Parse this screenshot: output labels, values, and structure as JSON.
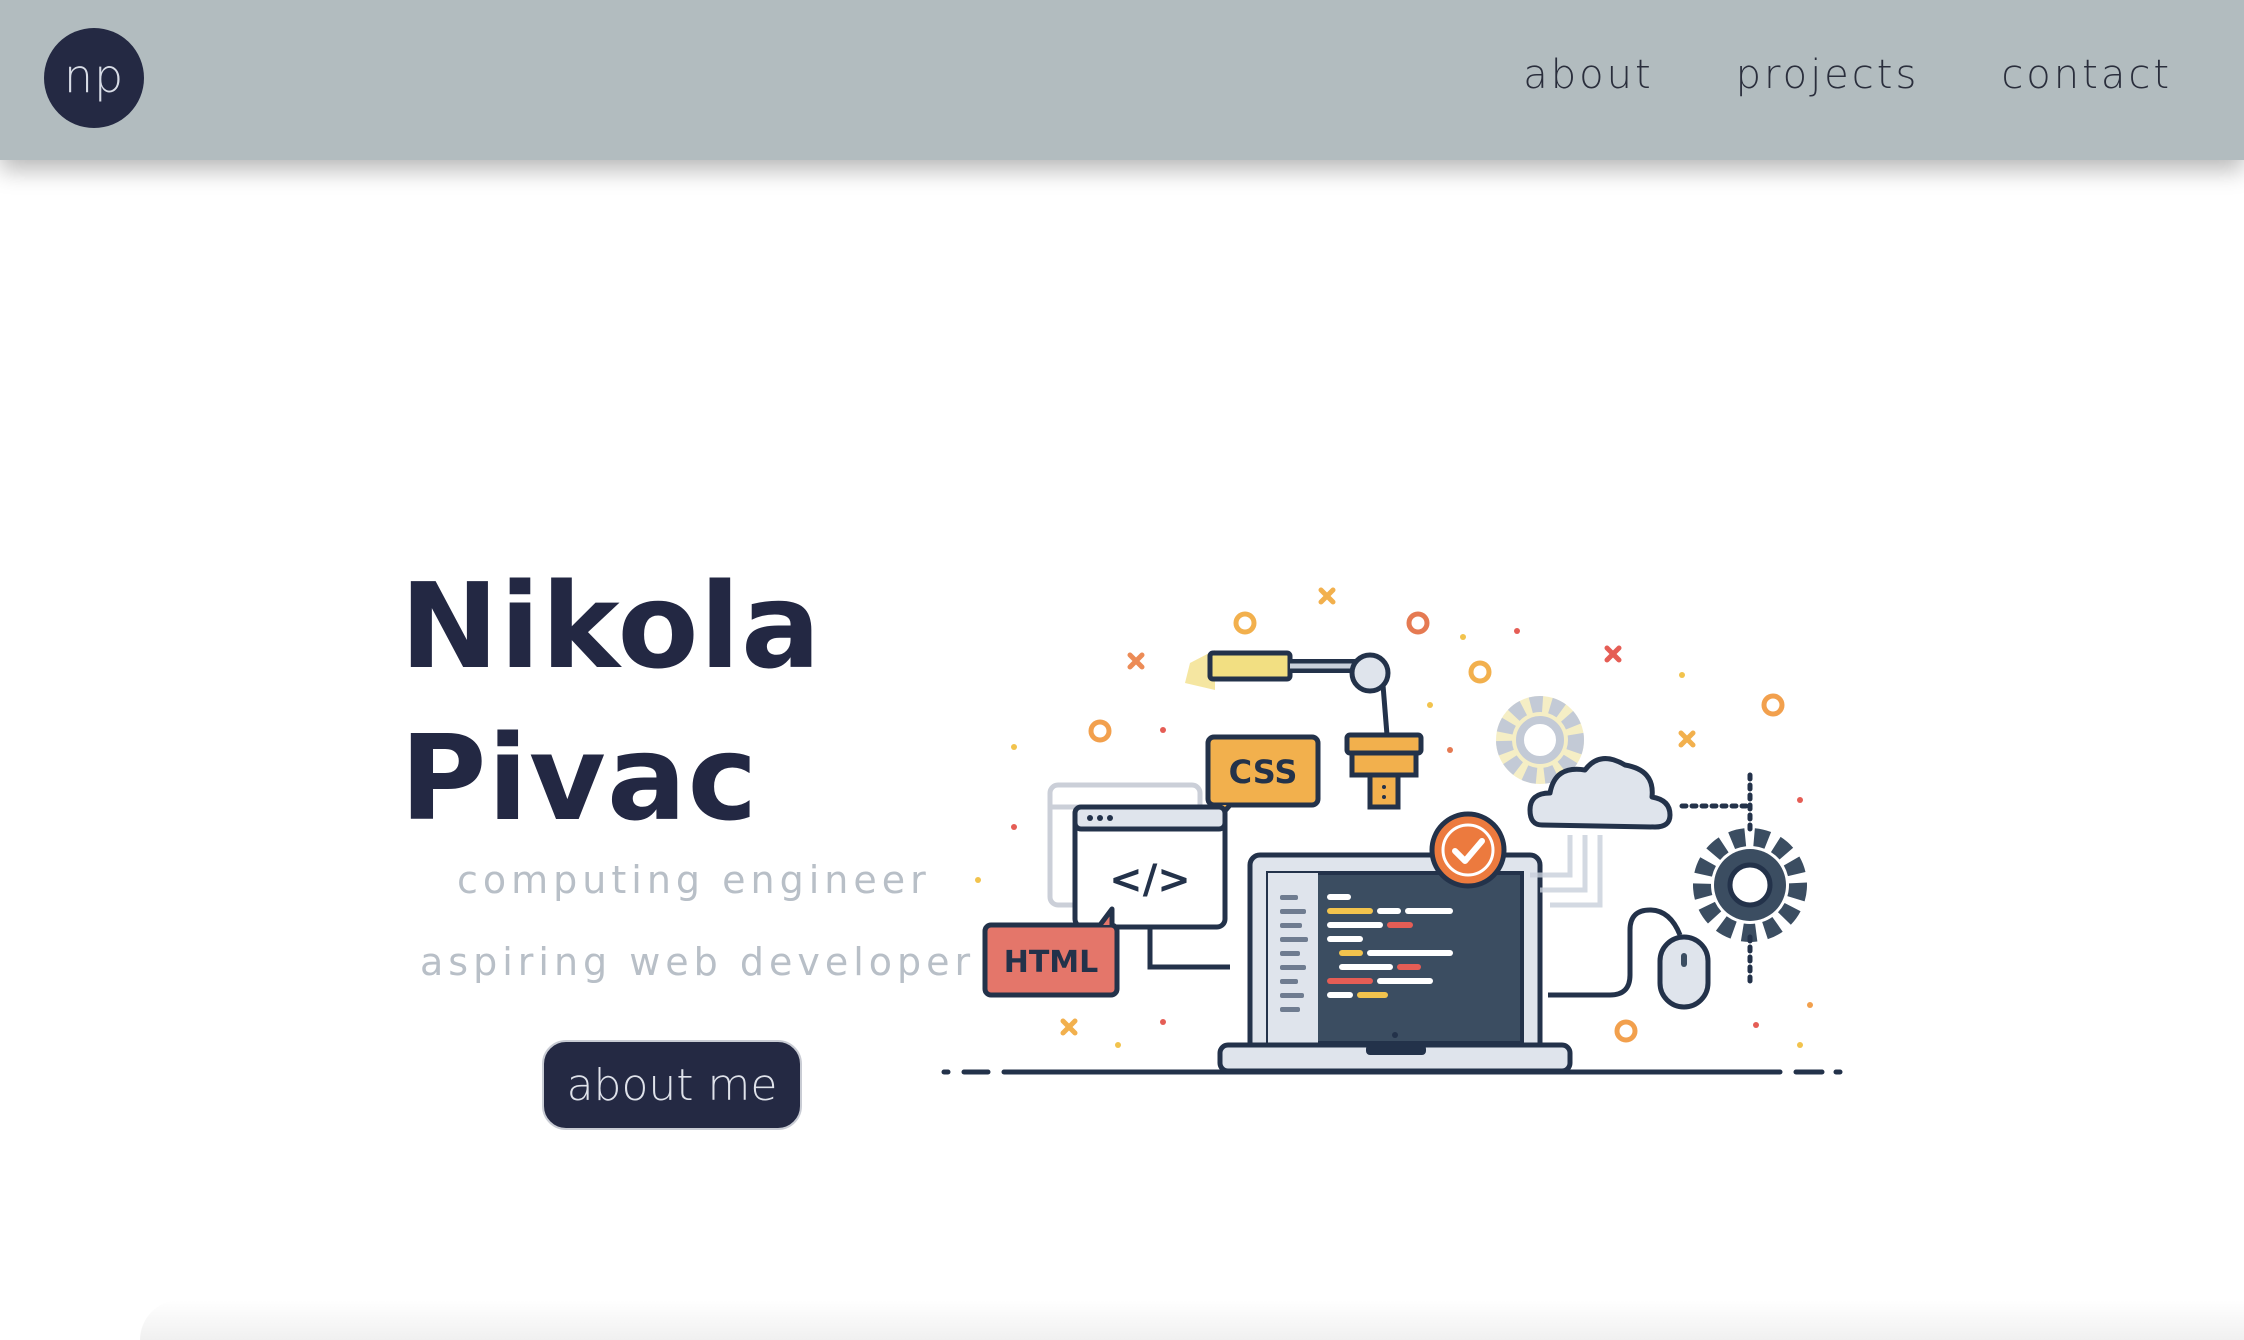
{
  "navbar": {
    "logo_text": "np",
    "links": [
      {
        "label": "about"
      },
      {
        "label": "projects"
      },
      {
        "label": "contact"
      }
    ],
    "background": "#b2bcbf"
  },
  "hero": {
    "first_name": "Nikola",
    "last_name": "Pivac",
    "subtitles": [
      "computing engineer",
      "aspiring web developer"
    ],
    "button_label": "about me",
    "accent": "#242943"
  },
  "illustration": {
    "html_tag": "HTML",
    "css_tag": "CSS",
    "code_tag": "</>"
  }
}
